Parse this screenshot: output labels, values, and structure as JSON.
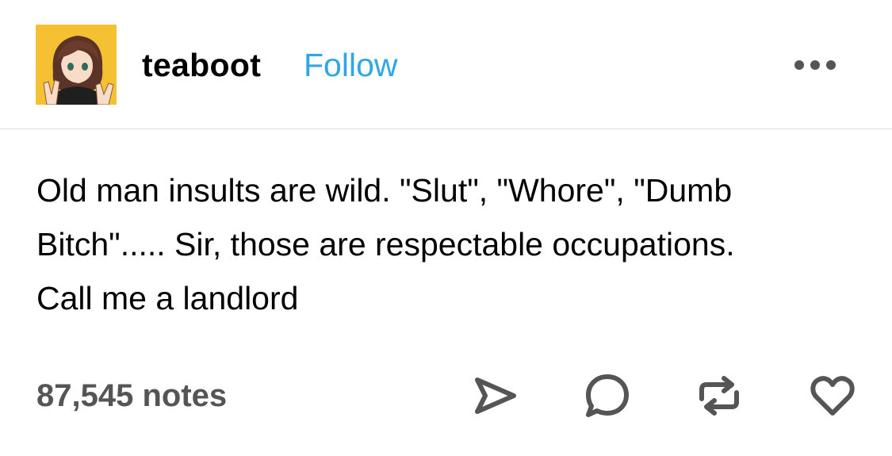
{
  "post": {
    "username": "teaboot",
    "follow_label": "Follow",
    "more_icon": "more-horizontal-icon",
    "text_lines": [
      "Old man insults are wild. \"Slut\", \"Whore\", \"Dumb",
      "Bitch\"..... Sir, those are respectable occupations.",
      "Call me a landlord"
    ],
    "notes_label": "87,545 notes",
    "actions": {
      "share_icon": "send-icon",
      "reply_icon": "comment-icon",
      "reblog_icon": "reblog-icon",
      "like_icon": "heart-icon"
    }
  },
  "colors": {
    "follow": "#2fa6e6",
    "avatar_background": "#f6c033",
    "notes_text": "#555555",
    "divider": "#d9d9d9"
  }
}
